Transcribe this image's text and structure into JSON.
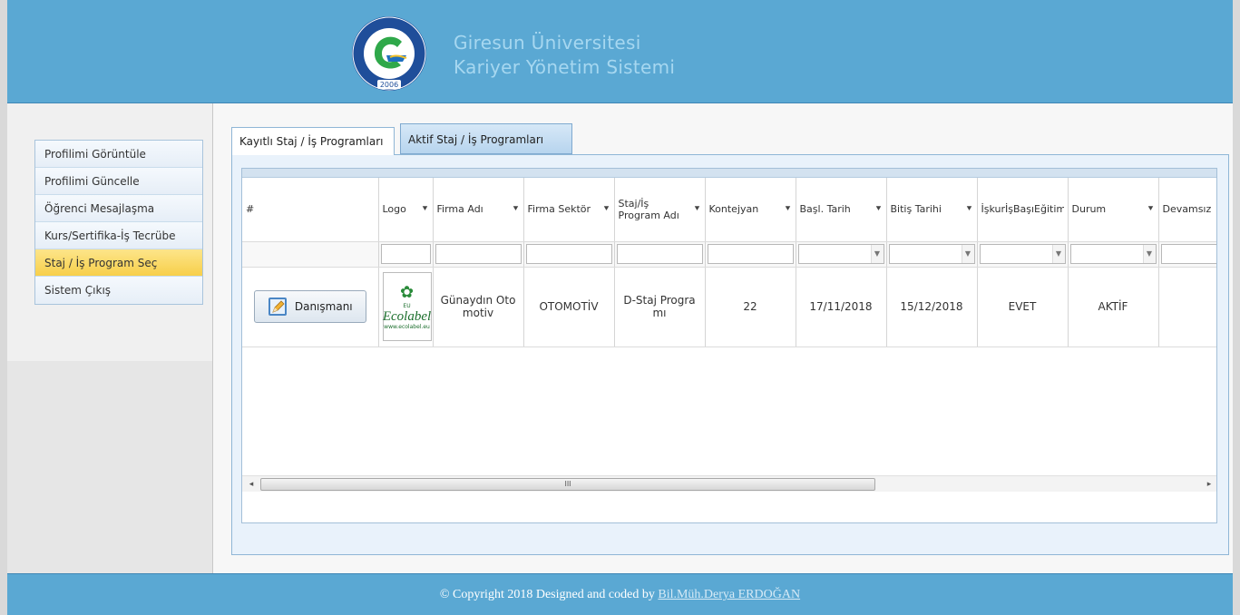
{
  "header": {
    "university_name": "Giresun Üniversitesi",
    "system_name": "Kariyer Yönetim Sistemi",
    "logo_seal_text": "GİRESUN ÜNİVERSİTESİ",
    "logo_year": "2006",
    "colors": {
      "bar": "#5aa8d3",
      "brand_text": "#a6d7f0"
    }
  },
  "sidebar": {
    "items": [
      {
        "label": "Profilimi Görüntüle",
        "active": false
      },
      {
        "label": "Profilimi Güncelle",
        "active": false
      },
      {
        "label": "Öğrenci Mesajlaşma",
        "active": false
      },
      {
        "label": "Kurs/Sertifika-İş Tecrübe",
        "active": false
      },
      {
        "label": "Staj / İş Program Seç",
        "active": true
      },
      {
        "label": "Sistem Çıkış",
        "active": false
      }
    ],
    "active_color": "#f7cf4a"
  },
  "tabs": [
    {
      "label": "Kayıtlı Staj / İş Programları",
      "selected": true
    },
    {
      "label": "Aktif Staj / İş Programları",
      "selected": false
    }
  ],
  "grid": {
    "columns": [
      {
        "label": "#",
        "filter": "none"
      },
      {
        "label": "Logo",
        "filter": "text"
      },
      {
        "label": "Firma Adı",
        "filter": "text"
      },
      {
        "label": "Firma Sektör",
        "filter": "text"
      },
      {
        "label": "Staj/İş Program Adı",
        "filter": "text"
      },
      {
        "label": "Kontejyan",
        "filter": "text"
      },
      {
        "label": "Başl. Tarih",
        "filter": "dropdown"
      },
      {
        "label": "Bitiş Tarihi",
        "filter": "dropdown"
      },
      {
        "label": "İşkurİşBaşıEğitim",
        "filter": "dropdown"
      },
      {
        "label": "Durum",
        "filter": "dropdown"
      },
      {
        "label": "Devamsız",
        "filter": "text"
      }
    ],
    "rows": [
      {
        "button_label": "Danışmanı",
        "logo_text": "Ecolabel",
        "logo_prefix": "EU",
        "logo_url": "www.ecolabel.eu",
        "company": "Günaydın Oto motiv",
        "sector": "OTOMOTİV",
        "program": "D-Staj Progra mı",
        "quota": "22",
        "start_date": "17/11/2018",
        "end_date": "15/12/2018",
        "iskur": "EVET",
        "status": "AKTİF",
        "absence": ""
      }
    ],
    "scroll_thumb_glyph": "III"
  },
  "footer": {
    "text": "© Copyright 2018 Designed and coded by",
    "author": "Bil.Müh.Derya ERDOĞAN"
  }
}
